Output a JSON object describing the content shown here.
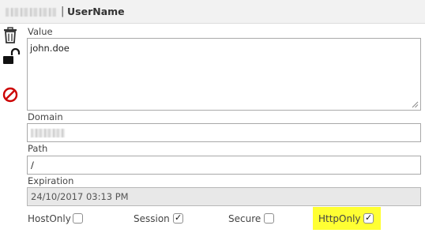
{
  "header": {
    "separator": "|",
    "cookie_name": "UserName"
  },
  "actions": [
    {
      "name": "delete",
      "icon": "trash-icon"
    },
    {
      "name": "unlock",
      "icon": "unlocked-padlock-icon"
    },
    {
      "name": "block",
      "icon": "no-entry-icon"
    }
  ],
  "value": {
    "label": "Value",
    "text": "john.doe"
  },
  "domain": {
    "label": "Domain",
    "text": ""
  },
  "path": {
    "label": "Path",
    "text": "/"
  },
  "expiration": {
    "label": "Expiration",
    "text": "24/10/2017 03:13 PM"
  },
  "flags": {
    "hostonly": {
      "label": "HostOnly",
      "checked": false
    },
    "session": {
      "label": "Session",
      "checked": true
    },
    "secure": {
      "label": "Secure",
      "checked": false
    },
    "httponly": {
      "label": "HttpOnly",
      "checked": true
    }
  },
  "colors": {
    "highlight": "#ffff33",
    "block_icon": "#cc0000"
  },
  "glyphs": {
    "check": "✓"
  }
}
